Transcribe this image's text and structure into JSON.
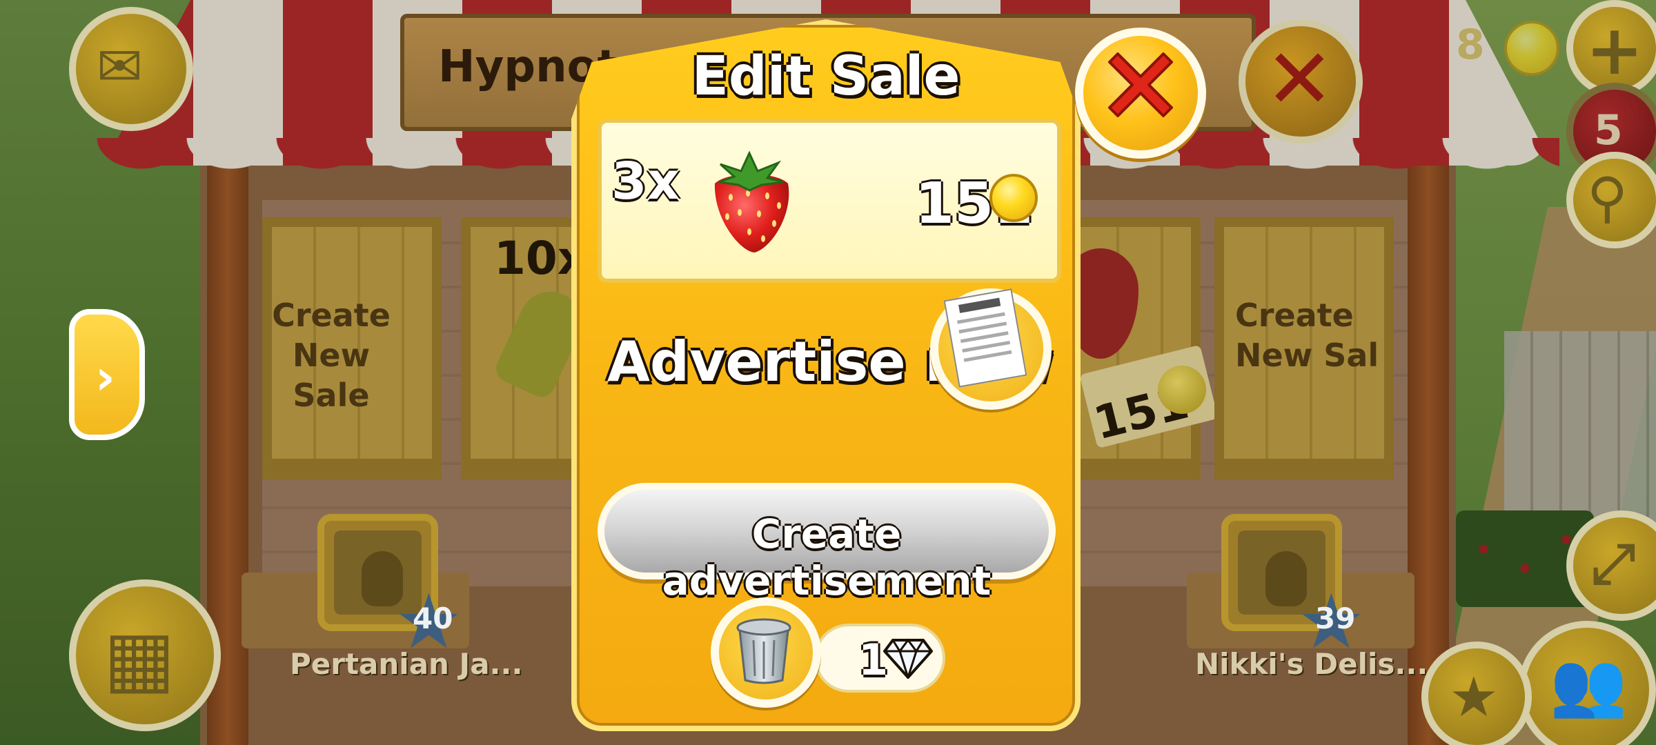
{
  "dialog": {
    "title": "Edit Sale",
    "item": {
      "quantity": "3x",
      "name": "strawberry",
      "price": "151",
      "currency_icon": "coin-icon"
    },
    "advertise_label": "Advertise now",
    "advertise_icon": "newspaper-icon",
    "create_ad_label": "Create advertisement",
    "delete": {
      "icon": "trash-can-icon",
      "cost": "1",
      "cost_icon": "diamond-icon"
    },
    "close_icon": "close-icon"
  },
  "background": {
    "shop_title_fragment": "Hypnot",
    "slots": [
      {
        "label_line1": "Create",
        "label_line2": "New Sale"
      },
      {
        "quantity": "10x"
      },
      {
        "price": "151"
      },
      {
        "label_line1": "Create",
        "label_line2": "New Sal"
      }
    ],
    "neighbors": [
      {
        "name": "Pertanian Ja...",
        "level": "40"
      },
      {
        "name": "Nikki's Delis...",
        "level": "39"
      }
    ],
    "hud": {
      "notifications": "5",
      "coins_fragment": "8"
    }
  },
  "colors": {
    "dialog_yellow": "#ffc21a",
    "panel_cream": "#fff6b8",
    "close_red": "#e02618",
    "text_outline": "#1a1006"
  }
}
